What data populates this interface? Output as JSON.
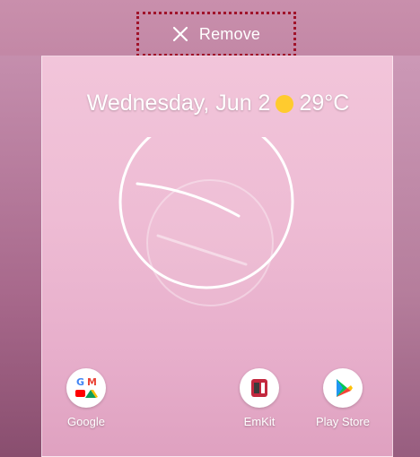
{
  "drop_target": {
    "label": "Remove",
    "icon": "close-icon"
  },
  "widget": {
    "date": "Wednesday, Jun 2",
    "weather_icon": "sun-icon",
    "temperature": "29°C"
  },
  "apps": [
    {
      "name": "Google",
      "icon": "google-folder-icon"
    },
    {
      "name": "EmKit",
      "icon": "emkit-icon"
    },
    {
      "name": "Play Store",
      "icon": "play-store-icon"
    }
  ],
  "colors": {
    "accent_border": "#a0132a",
    "sun": "#ffcb2e"
  }
}
